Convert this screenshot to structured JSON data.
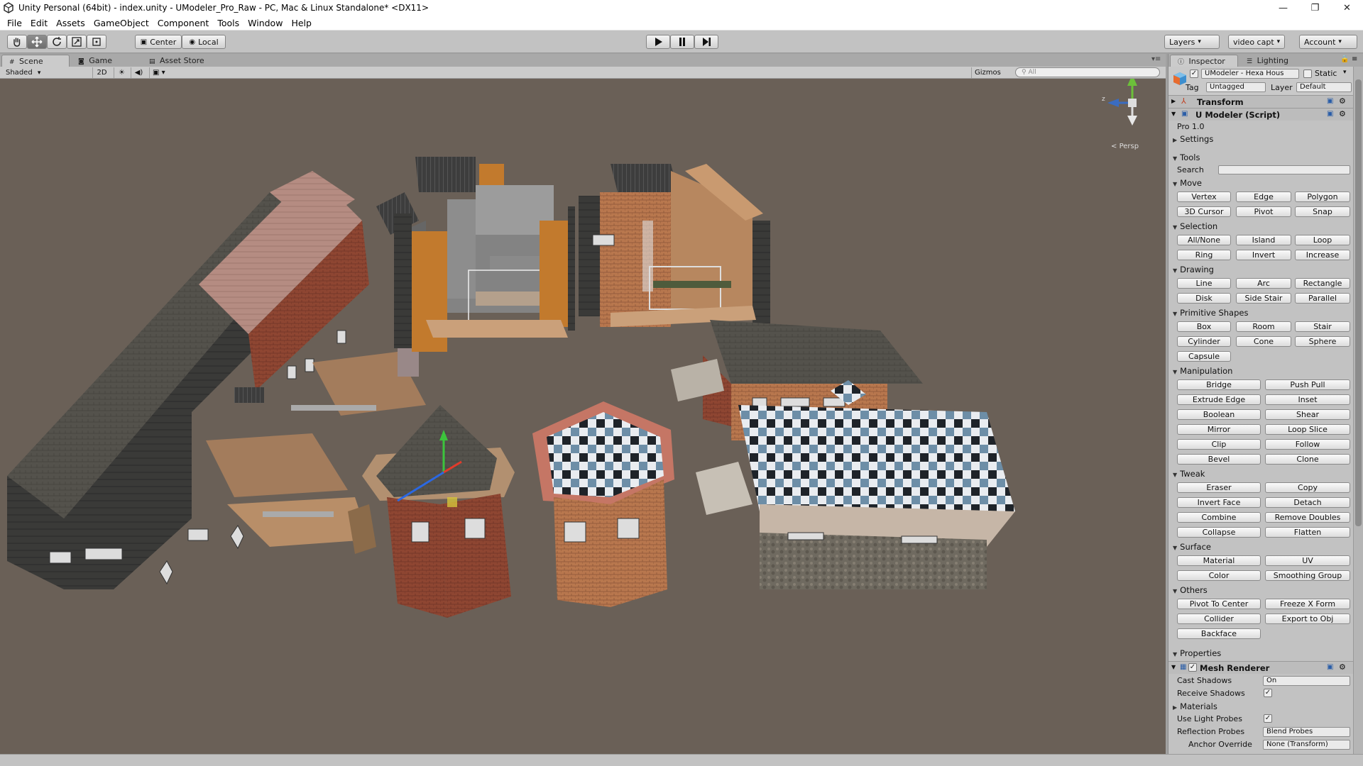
{
  "window": {
    "title": "Unity Personal (64bit) - index.unity - UModeler_Pro_Raw - PC, Mac & Linux Standalone* <DX11>",
    "minimize": "—",
    "restore": "❐",
    "close": "✕"
  },
  "menu": [
    "File",
    "Edit",
    "Assets",
    "GameObject",
    "Component",
    "Tools",
    "Window",
    "Help"
  ],
  "toolbar": {
    "center_label": "Center",
    "local_label": "Local",
    "layers_label": "Layers",
    "video_label": "video capt",
    "account_label": "Account"
  },
  "scene_tabs": {
    "scene": "Scene",
    "game": "Game",
    "asset_store": "Asset Store"
  },
  "scene_toolbar": {
    "shading": "Shaded",
    "mode_2d": "2D",
    "gizmos": "Gizmos",
    "search_placeholder": "All"
  },
  "viewport": {
    "persp_label": "Persp",
    "gizmo_axes": {
      "y": "y",
      "z": "z"
    }
  },
  "inspector": {
    "tab_inspector": "Inspector",
    "tab_lighting": "Lighting",
    "object_name": "UModeler - Hexa Hous",
    "static_label": "Static",
    "tag_label": "Tag",
    "tag_value": "Untagged",
    "layer_label": "Layer",
    "layer_value": "Default",
    "transform": "Transform",
    "script_name": "U Modeler (Script)",
    "version": "Pro 1.0",
    "settings": "Settings",
    "tools": "Tools",
    "search_label": "Search",
    "sections": {
      "move": {
        "title": "Move",
        "buttons": [
          "Vertex",
          "Edge",
          "Polygon",
          "3D Cursor",
          "Pivot",
          "Snap"
        ]
      },
      "selection": {
        "title": "Selection",
        "buttons": [
          "All/None",
          "Island",
          "Loop",
          "Ring",
          "Invert",
          "Increase"
        ]
      },
      "drawing": {
        "title": "Drawing",
        "buttons": [
          "Line",
          "Arc",
          "Rectangle",
          "Disk",
          "Side Stair",
          "Parallel"
        ]
      },
      "primitive": {
        "title": "Primitive Shapes",
        "buttons": [
          "Box",
          "Room",
          "Stair",
          "Cylinder",
          "Cone",
          "Sphere",
          "Capsule"
        ]
      },
      "manipulation": {
        "title": "Manipulation",
        "buttons": [
          "Bridge",
          "Push Pull",
          "Extrude Edge",
          "Inset",
          "Boolean",
          "Shear",
          "Mirror",
          "Loop Slice",
          "Clip",
          "Follow",
          "Bevel",
          "Clone"
        ]
      },
      "tweak": {
        "title": "Tweak",
        "buttons": [
          "Eraser",
          "Copy",
          "Invert Face",
          "Detach",
          "Combine",
          "Remove Doubles",
          "Collapse",
          "Flatten"
        ]
      },
      "surface": {
        "title": "Surface",
        "buttons": [
          "Material",
          "UV",
          "Color",
          "Smoothing Group"
        ]
      },
      "others": {
        "title": "Others",
        "buttons": [
          "Pivot To Center",
          "Freeze X Form",
          "Collider",
          "Export to Obj",
          "Backface"
        ]
      }
    },
    "properties": "Properties",
    "mesh_renderer": "Mesh Renderer",
    "cast_shadows_label": "Cast Shadows",
    "cast_shadows_value": "On",
    "receive_shadows_label": "Receive Shadows",
    "materials_label": "Materials",
    "use_light_probes_label": "Use Light Probes",
    "reflection_probes_label": "Reflection Probes",
    "reflection_probes_value": "Blend Probes",
    "anchor_override_label": "Anchor Override",
    "anchor_override_value": "None (Transform)"
  }
}
